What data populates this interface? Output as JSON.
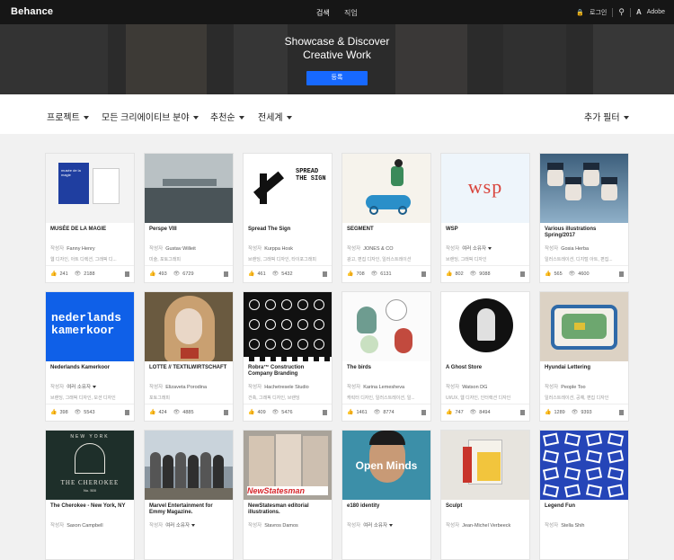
{
  "topbar": {
    "logo": "Behance",
    "nav": [
      "검색",
      "직업"
    ],
    "login": "로그인",
    "brand": "Adobe"
  },
  "hero": {
    "line1": "Showcase & Discover",
    "line2": "Creative Work",
    "button": "등록"
  },
  "filters": {
    "projects": "프로젝트",
    "fields": "모든 크리에이티브 분야",
    "sort": "추천순",
    "region": "전세계",
    "more": "추가 필터"
  },
  "author_label": "작성자",
  "cards": [
    {
      "title": "MUSÉE DE LA MAGIE",
      "author": "Fanny Henry",
      "tags": "웹 디자인, 아트 디렉션, 그래픽 디...",
      "likes": "241",
      "views": "2188",
      "bg": "#f3f3f3",
      "accent": "#1f3ea0"
    },
    {
      "title": "Perspe VIII",
      "author": "Gustav Willeit",
      "tags": "미술, 포토그래피",
      "likes": "493",
      "views": "6729",
      "bg": "#8e9aa0",
      "accent": "#4a5458"
    },
    {
      "title": "Spread The Sign",
      "author": "Kurppa Hosk",
      "tags": "브랜딩, 그래픽 디자인, 타이포그래피",
      "likes": "461",
      "views": "5432",
      "bg": "#ffffff",
      "accent": "#111111"
    },
    {
      "title": "SEGMENT",
      "author": "JONES & CO",
      "tags": "광고, 편집 디자인, 일러스트레이션",
      "likes": "708",
      "views": "6131",
      "bg": "#f6f3ec",
      "accent": "#2a8fc9"
    },
    {
      "title": "WSP",
      "author": "여러 소유자",
      "tags": "브랜딩, 그래픽 디자인",
      "likes": "802",
      "views": "9088",
      "bg": "#eef5fb",
      "accent": "#d9443c"
    },
    {
      "title": "Various illustrations Spring/2017",
      "author": "Gosia Herba",
      "tags": "일러스트레이션, 디지털 아트, 편집...",
      "likes": "565",
      "views": "4600",
      "bg": "#6f91ad",
      "accent": "#27384a"
    },
    {
      "title": "Nederlands Kamerkoor",
      "author": "여러 소유자",
      "tags": "브랜딩, 그래픽 디자인, 모션 디자인",
      "likes": "398",
      "views": "5543",
      "bg": "#0f60e8",
      "accent": "#ffffff"
    },
    {
      "title": "LOTTE // TEXTILWIRTSCHAFT",
      "author": "Elizaveta Porodina",
      "tags": "포토그래피",
      "likes": "424",
      "views": "4885",
      "bg": "#6a5a40",
      "accent": "#c9a071"
    },
    {
      "title": "Robra™ Construction Company Branding",
      "author": "Hachetresele Studio",
      "tags": "건축, 그래픽 디자인, 브랜딩",
      "likes": "409",
      "views": "5476",
      "bg": "#111111",
      "accent": "#ffffff"
    },
    {
      "title": "The birds",
      "author": "Karina Lemesheva",
      "tags": "캐릭터 디자인, 일러스트레이션, 일...",
      "likes": "1461",
      "views": "8774",
      "bg": "#fbfbfb",
      "accent": "#3b7a6a"
    },
    {
      "title": "A Ghost Store",
      "author": "Watson DG",
      "tags": "UI/UX, 웹 디자인, 인터랙션 디자인",
      "likes": "747",
      "views": "8494",
      "bg": "#ffffff",
      "accent": "#222222"
    },
    {
      "title": "Hyundai Lettering",
      "author": "People Too",
      "tags": "일러스트레이션, 공예, 편집 디자인",
      "likes": "1289",
      "views": "9393",
      "bg": "#dcd2c4",
      "accent": "#3d6fb0"
    },
    {
      "title": "The Cherokee - New York, NY",
      "author": "Saxon Campbell",
      "tags": "",
      "likes": "",
      "views": "",
      "bg": "#1e2f2a",
      "accent": "#e8e6df"
    },
    {
      "title": "Marvel Entertainment for Emmy Magazine.",
      "author": "여러 소유자",
      "tags": "",
      "likes": "",
      "views": "",
      "bg": "#8a96a0",
      "accent": "#3b3b3b"
    },
    {
      "title": "NewStatesman editorial illustrations.",
      "author": "Stavros Damos",
      "tags": "",
      "likes": "",
      "views": "",
      "bg": "#a9a39a",
      "accent": "#d7262b"
    },
    {
      "title": "e180 identity",
      "author": "여러 소유자",
      "tags": "",
      "likes": "",
      "views": "",
      "bg": "#3c8fa8",
      "accent": "#ffffff"
    },
    {
      "title": "Sculpt",
      "author": "Jean-Michel Verbeeck",
      "tags": "",
      "likes": "",
      "views": "",
      "bg": "#e7e4de",
      "accent": "#c8342b"
    },
    {
      "title": "Legend Fun",
      "author": "Stella Shih",
      "tags": "",
      "likes": "",
      "views": "",
      "bg": "#2545b8",
      "accent": "#ffffff"
    }
  ],
  "thumb_text": {
    "spread": "SPREAD THE SIGN",
    "wsp": "wsp",
    "kamerkoor": "nederlands kamerkoor",
    "newyork": "NEW YORK",
    "cherokee": "THE CHEROKEE",
    "cherokee_no": "No. 500",
    "newstatesman": "NewStatesman",
    "openminds": "Open Minds",
    "museum": "musée de la magie"
  }
}
